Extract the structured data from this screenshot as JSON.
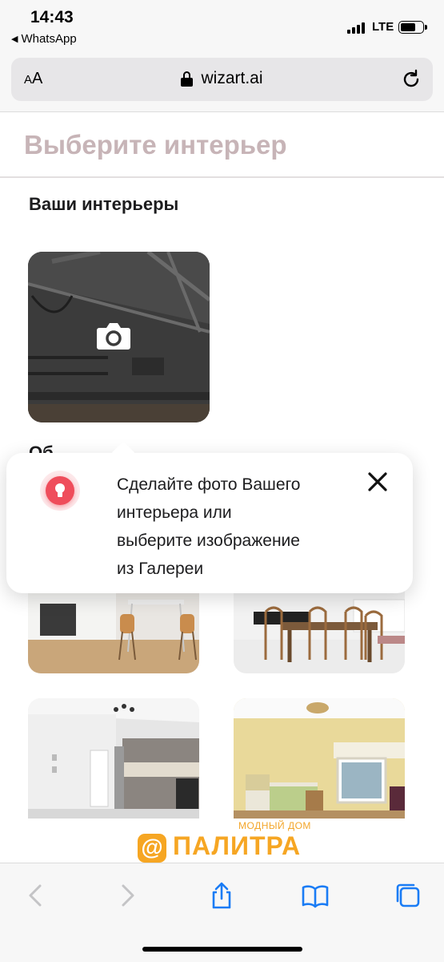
{
  "status_bar": {
    "time": "14:43",
    "back_app_label": "WhatsApp",
    "back_icon": "back-triangle-icon",
    "network": "LTE"
  },
  "browser": {
    "text_size_label": "AA",
    "url": "wizart.ai",
    "lock_icon": "lock-icon",
    "reload_icon": "reload-icon"
  },
  "page": {
    "title": "Выберите интерьер",
    "your_interiors_heading": "Ваши интерьеры",
    "peek_heading": "Об"
  },
  "tooltip": {
    "lines": [
      "Сделайте фото Вашего",
      "интерьера или",
      "выберите изображение",
      "из Галереи"
    ],
    "icon": "lightbulb-icon",
    "close_icon": "close-icon"
  },
  "logo": {
    "subtitle": "МОДНЫЙ ДОМ",
    "mark": "@",
    "name": "ПАЛИТРА"
  },
  "toolbar": {
    "items": [
      "back-icon",
      "forward-icon",
      "share-icon",
      "bookmarks-icon",
      "tabs-icon"
    ]
  },
  "colors": {
    "title": "#c7b4b7",
    "accent_red": "#ef4d5b",
    "brand_orange": "#f6a623",
    "ios_blue": "#1a7cf5"
  }
}
